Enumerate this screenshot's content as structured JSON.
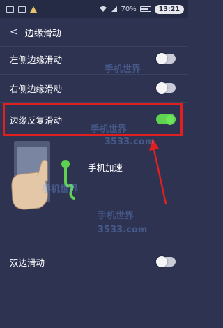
{
  "status_bar": {
    "battery_text": "70%",
    "time": "13:21"
  },
  "header": {
    "back_icon": "back-arrow-icon",
    "title": "边缘滑动"
  },
  "settings": [
    {
      "label": "左侧边缘滑动",
      "enabled": false
    },
    {
      "label": "右侧边缘滑动",
      "enabled": false
    },
    {
      "label": "边缘反复滑动",
      "enabled": true
    },
    {
      "label": "双边滑动",
      "enabled": false
    }
  ],
  "illustration": {
    "caption": "手机加速"
  },
  "colors": {
    "background": "#2e3352",
    "toggle_on": "#5fd34f",
    "toggle_off": "#c9ccd6",
    "highlight": "#e02020"
  }
}
